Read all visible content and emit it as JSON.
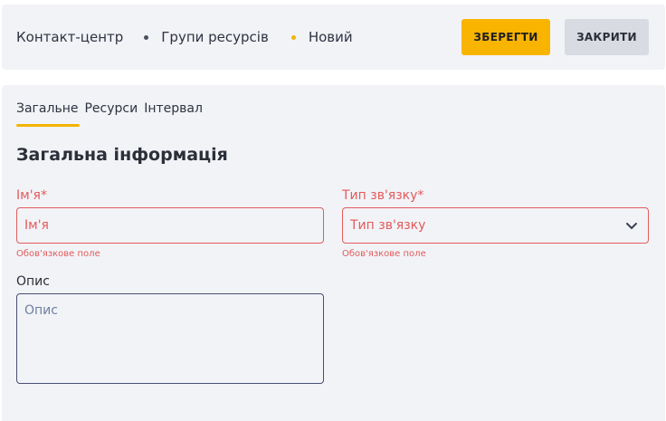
{
  "breadcrumb": {
    "items": [
      "Контакт-центр",
      "Групи ресурсів",
      "Новий"
    ]
  },
  "toolbar": {
    "save_label": "ЗБЕРЕГТИ",
    "close_label": "ЗАКРИТИ"
  },
  "tabs": [
    {
      "label": "Загальне",
      "active": true
    },
    {
      "label": "Ресурси",
      "active": false
    },
    {
      "label": "Інтервал",
      "active": false
    }
  ],
  "section": {
    "title": "Загальна інформація"
  },
  "form": {
    "name": {
      "label": "Ім'я*",
      "placeholder": "Ім'я",
      "error": "Обов'язкове поле"
    },
    "contact_type": {
      "label": "Тип зв'язку*",
      "placeholder": "Тип зв'язку",
      "error": "Обов'язкове поле",
      "icon": "chevron-down-icon"
    },
    "description": {
      "label": "Опис",
      "placeholder": "Опис"
    }
  },
  "colors": {
    "accent": "#f9b400",
    "error": "#e35b5b",
    "panel": "#f2f3f7"
  }
}
